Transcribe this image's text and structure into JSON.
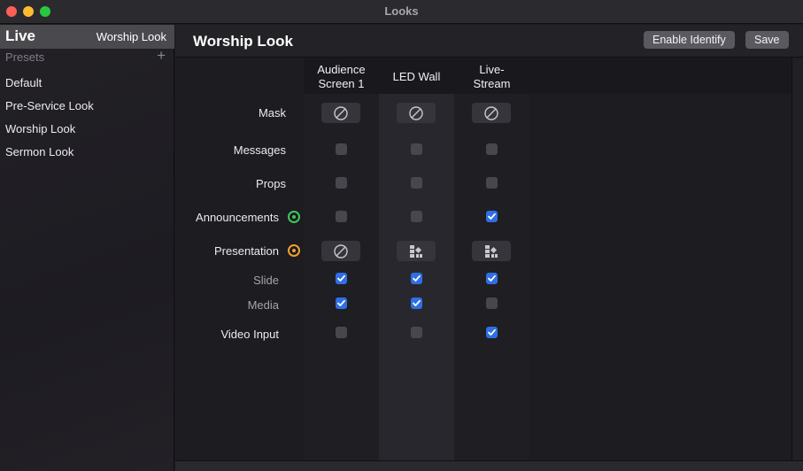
{
  "window": {
    "title": "Looks"
  },
  "sidebar": {
    "live_label": "Live",
    "live_look": "Worship Look",
    "presets_header": "Presets",
    "add_icon": "plus-icon",
    "presets": [
      "Default",
      "Pre-Service Look",
      "Worship Look",
      "Sermon Look"
    ]
  },
  "header": {
    "title": "Worship Look",
    "identify_label": "Enable Identify",
    "save_label": "Save"
  },
  "columns": [
    "Audience\nScreen 1",
    "LED Wall",
    "Live-\nStream"
  ],
  "rows": {
    "mask": {
      "label": "Mask",
      "values": [
        "none-icon",
        "none-icon",
        "none-icon"
      ]
    },
    "messages": {
      "label": "Messages",
      "values": [
        false,
        false,
        false
      ]
    },
    "props": {
      "label": "Props",
      "values": [
        false,
        false,
        false
      ]
    },
    "announcements": {
      "label": "Announcements",
      "status_color": "#3cc95a",
      "values": [
        false,
        false,
        true
      ]
    },
    "presentation": {
      "label": "Presentation",
      "status_color": "#f0a030",
      "values": [
        "none-icon",
        "layout-icon",
        "layout-icon"
      ]
    },
    "slide": {
      "label": "Slide",
      "values": [
        true,
        true,
        true
      ]
    },
    "media": {
      "label": "Media",
      "values": [
        true,
        true,
        false
      ]
    },
    "video_input": {
      "label": "Video Input",
      "values": [
        false,
        false,
        true
      ]
    }
  },
  "colors": {
    "accent": "#2f6fe4",
    "live_highlight": "#4a4a4e"
  }
}
